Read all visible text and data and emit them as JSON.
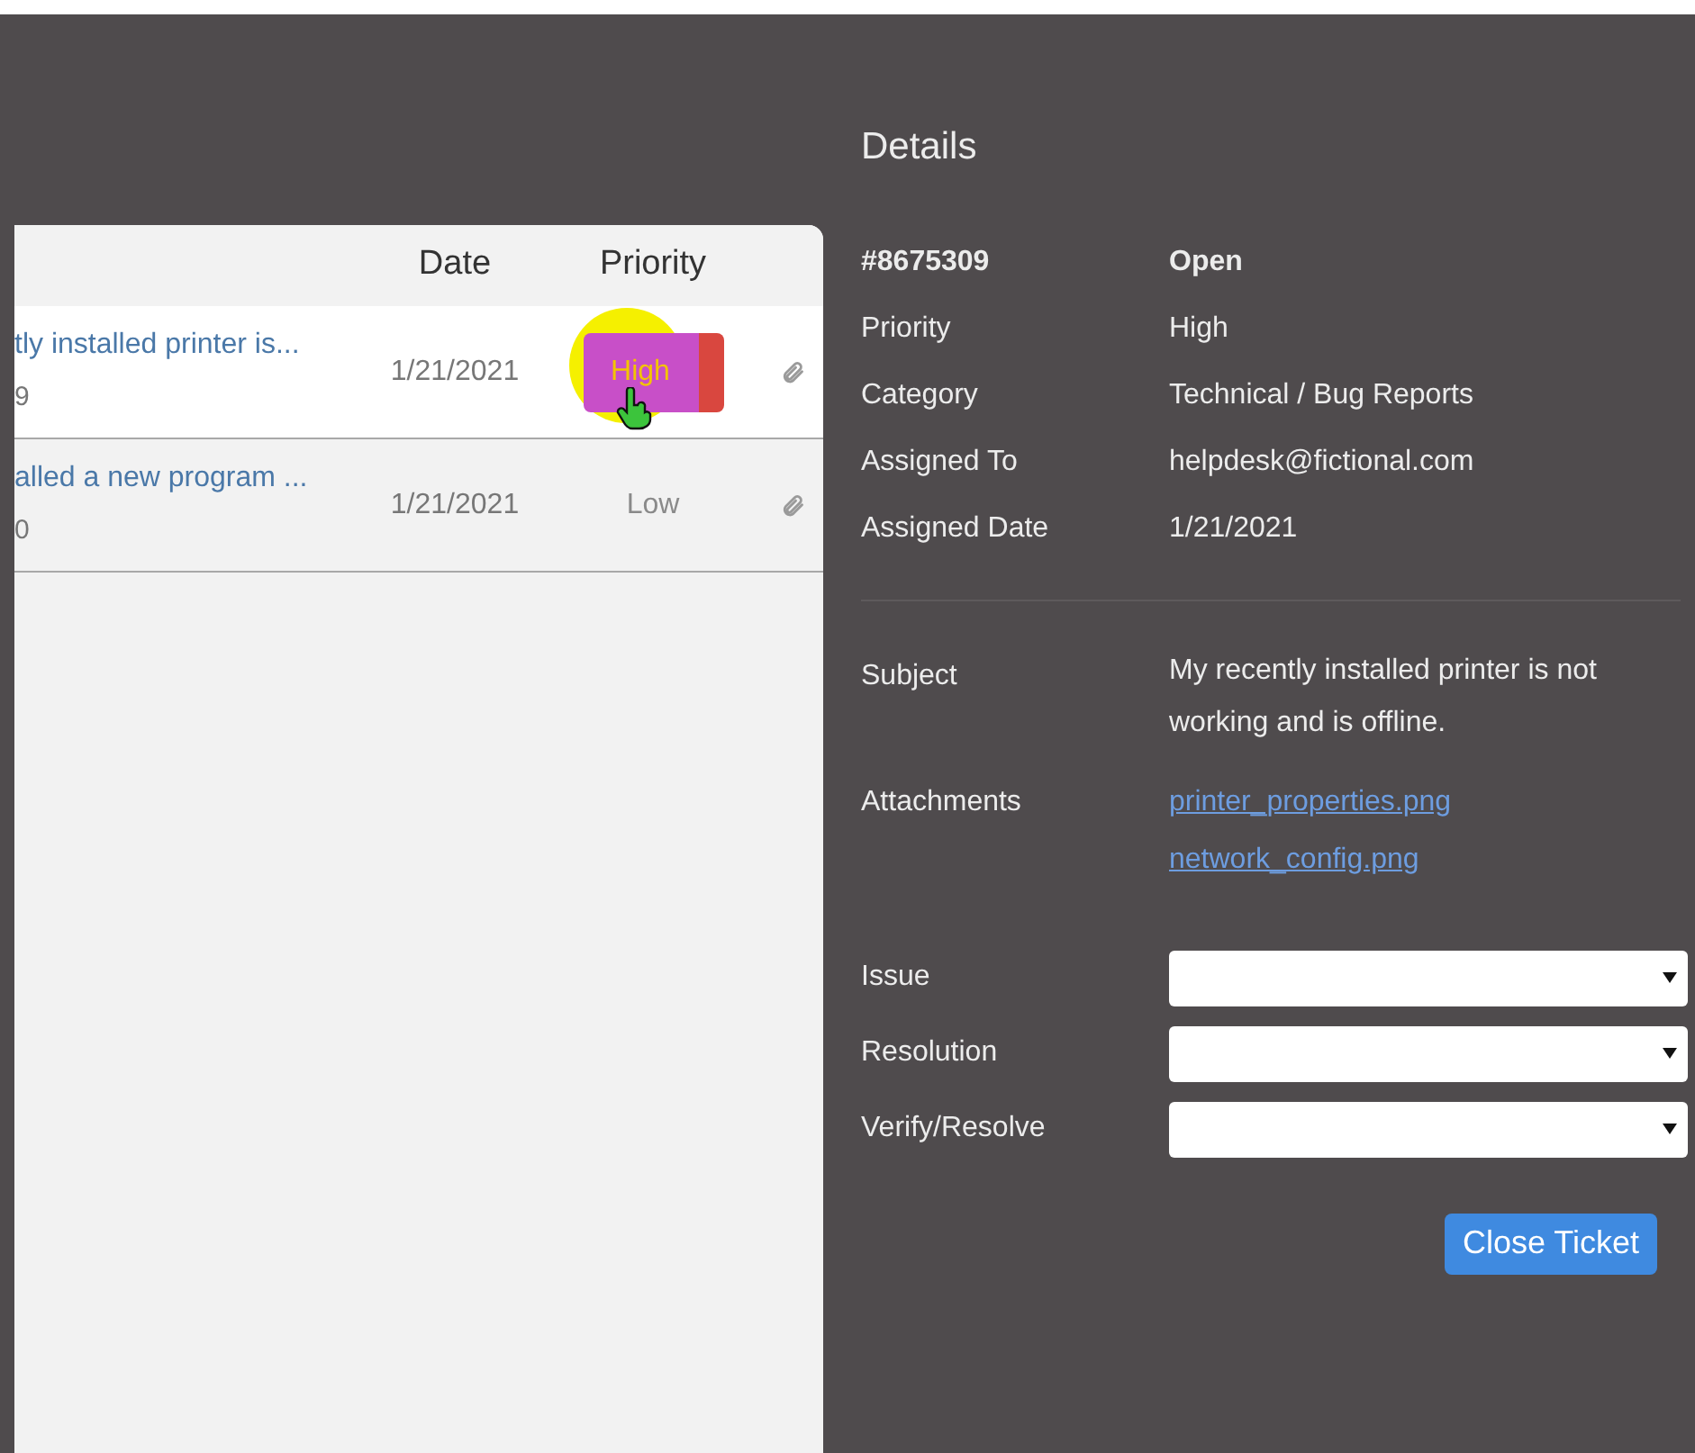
{
  "tickets": {
    "columns": [
      "Date",
      "Priority"
    ],
    "rows": [
      {
        "subject": "tly installed printer is...",
        "id": "9",
        "date": "1/21/2021",
        "priority": "High",
        "kind": "badge",
        "color": "#c84fc8",
        "selected": true
      },
      {
        "subject": "alled a new program ...",
        "id": "0",
        "date": "1/21/2021",
        "priority": "Low",
        "kind": "text",
        "selected": false
      }
    ]
  },
  "details": {
    "title": "Details",
    "header": {
      "number": "#8675309",
      "status": "Open"
    },
    "fields": [
      {
        "label": "Priority",
        "value": "High"
      },
      {
        "label": "Category",
        "value": "Technical / Bug Reports"
      },
      {
        "label": "Assigned To",
        "value": "helpdesk@fictional.com"
      },
      {
        "label": "Assigned Date",
        "value": "1/21/2021"
      }
    ],
    "subject": {
      "label": "Subject",
      "value": "My recently installed printer is not working and is offline."
    },
    "attachments": {
      "label": "Attachments",
      "files": [
        "printer_properties.png",
        "network_config.png"
      ]
    },
    "selects": [
      {
        "label": "Issue"
      },
      {
        "label": "Resolution"
      },
      {
        "label": "Verify/Resolve"
      }
    ],
    "button": "Close Ticket"
  }
}
